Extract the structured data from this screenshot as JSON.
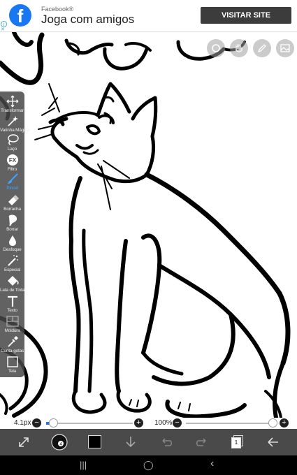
{
  "ad": {
    "sponsor": "Facebook®",
    "headline": "Joga com amigos",
    "cta": "VISITAR SITE",
    "logo_letter": "f",
    "ad_choice_icon": "info-icon",
    "close_glyph": "✕"
  },
  "toolbar": {
    "tools": [
      {
        "label": "Transformar",
        "icon": "move-arrows-icon"
      },
      {
        "label": "Varinha Mágica",
        "icon": "magic-wand-icon"
      },
      {
        "label": "Laço",
        "icon": "lasso-icon"
      },
      {
        "label": "Filtro",
        "icon": "fx-icon"
      },
      {
        "label": "Pincel",
        "icon": "brush-icon"
      },
      {
        "label": "Borracha",
        "icon": "eraser-icon"
      },
      {
        "label": "Borrar",
        "icon": "smudge-icon"
      },
      {
        "label": "Desfoque",
        "icon": "blur-drop-icon"
      },
      {
        "label": "Especial",
        "icon": "special-wand-icon"
      },
      {
        "label": "Lata de Tinta",
        "icon": "paint-bucket-icon"
      },
      {
        "label": "Texto",
        "icon": "text-icon"
      },
      {
        "label": "Moldura",
        "icon": "frame-icon"
      },
      {
        "label": "Conta-gotas",
        "icon": "eyedropper-icon"
      },
      {
        "label": "Tela",
        "icon": "canvas-icon"
      }
    ],
    "active_tool": "Pincel",
    "active_color": "#3da5ff"
  },
  "sizebar": {
    "brush_size": "4.1px",
    "brush_level": 0.08,
    "opacity": "100%",
    "opacity_level": 1.0,
    "minus": "−",
    "plus": "+",
    "accent": "#2f6fd0"
  },
  "bottombar": {
    "primary_color": "#000000",
    "icons": [
      "transform-icon",
      "brush-settings-icon",
      "color-swatch-icon",
      "download-icon",
      "undo-icon",
      "redo-icon",
      "layers-icon",
      "back-arrow-icon"
    ],
    "layer_count": "1"
  },
  "navbar": {
    "recents": "|||",
    "home": "◯",
    "back": "‹"
  },
  "canvas_buttons": [
    "record-icon",
    "hand-icon",
    "pen-icon",
    "gallery-icon"
  ]
}
